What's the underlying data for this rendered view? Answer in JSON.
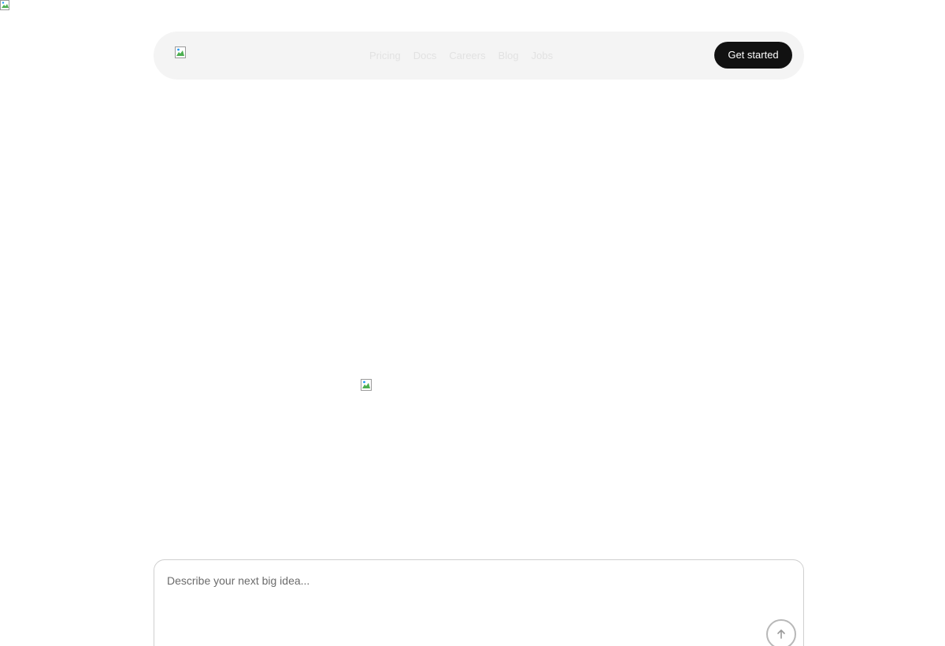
{
  "header": {
    "nav_links": [
      "Pricing",
      "Docs",
      "Careers",
      "Blog",
      "Jobs"
    ],
    "cta_label": "Get started"
  },
  "prompt": {
    "placeholder": "Describe your next big idea...",
    "value": "",
    "submit_icon": "arrow-up-icon"
  },
  "colors": {
    "cta_background": "#111111",
    "cta_text": "#ffffff",
    "navbar_background": "#f4f4f4",
    "nav_link_text": "#e2e2e2",
    "placeholder_text": "#6b6b6b"
  }
}
